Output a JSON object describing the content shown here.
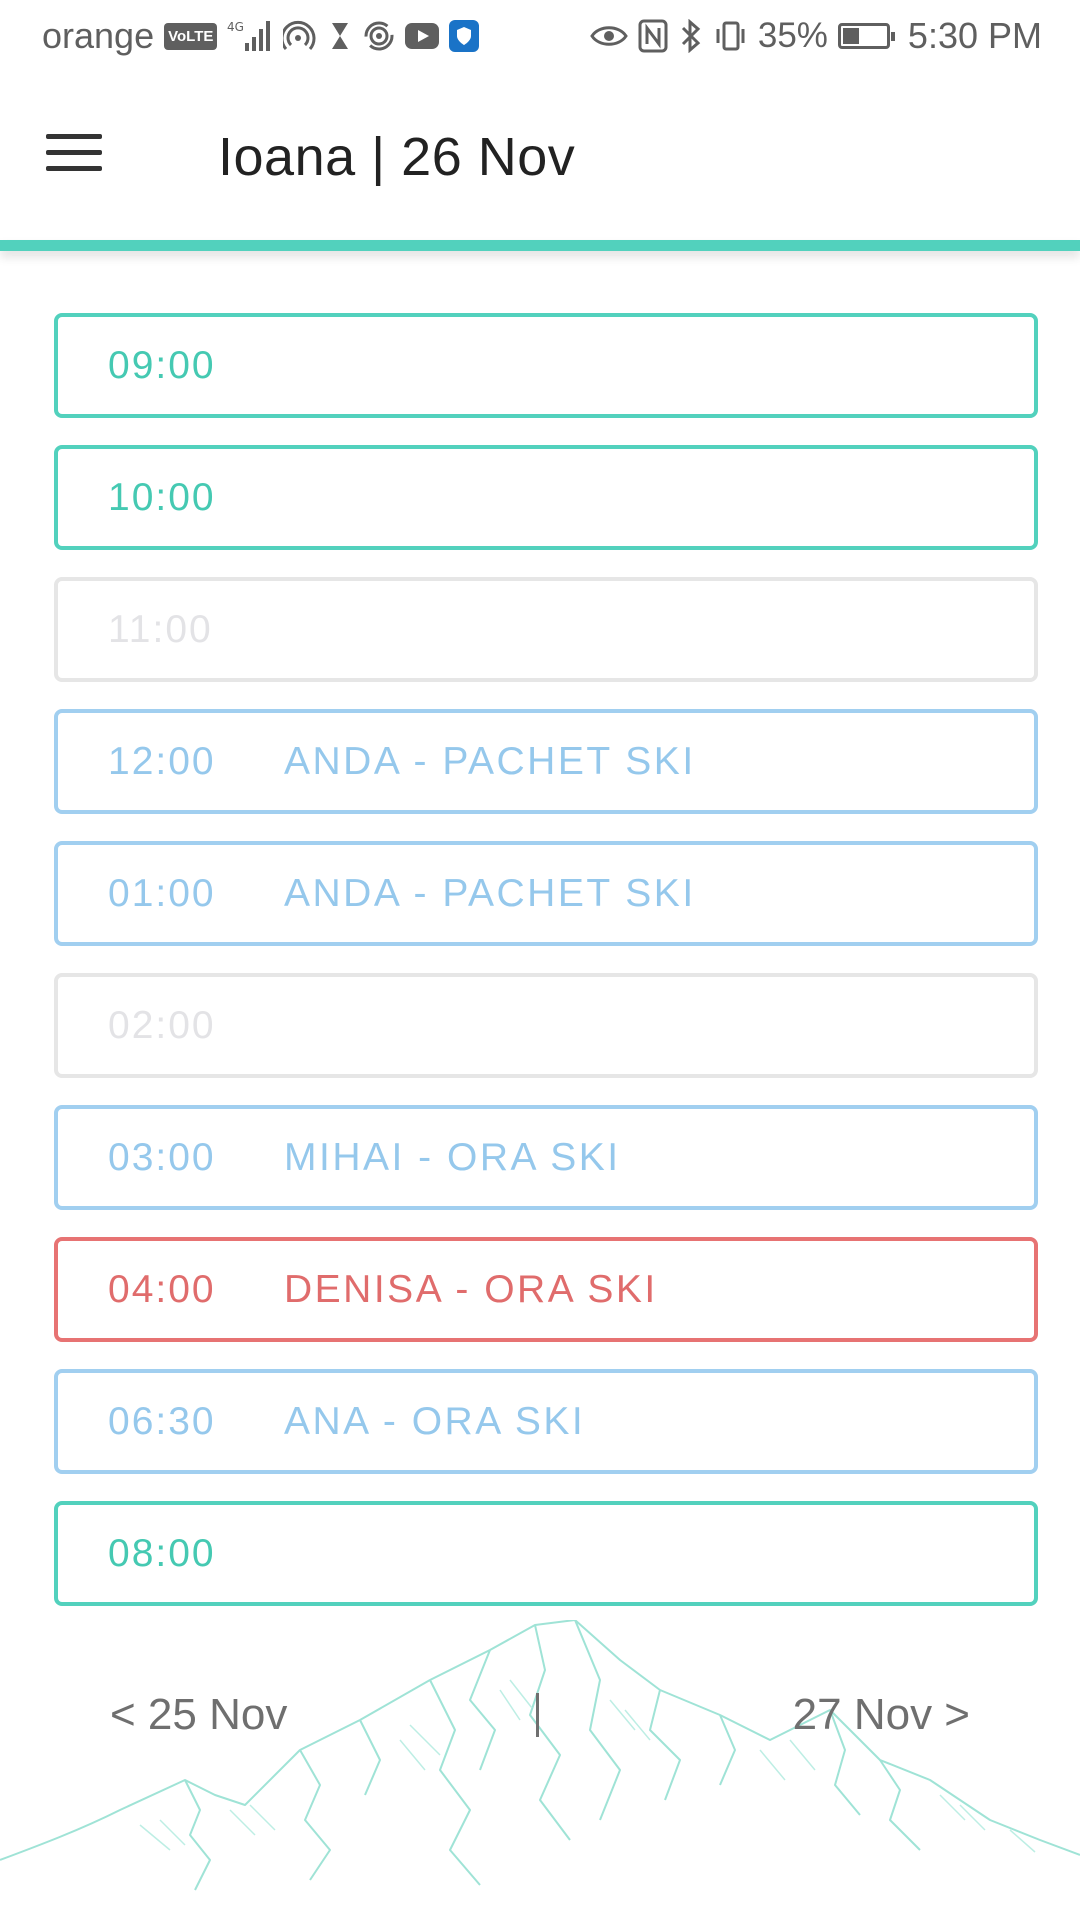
{
  "status_bar": {
    "carrier": "orange",
    "volte_badge": "VoLTE",
    "network": "4G",
    "battery": "35%",
    "time": "5:30 PM"
  },
  "header": {
    "title": "Ioana | 26 Nov",
    "accent_color": "#52d1bd"
  },
  "slots": [
    {
      "time": "09:00",
      "booking": "",
      "status": "available"
    },
    {
      "time": "10:00",
      "booking": "",
      "status": "available"
    },
    {
      "time": "11:00",
      "booking": "",
      "status": "disabled"
    },
    {
      "time": "12:00",
      "booking": "ANDA - PACHET SKI",
      "status": "booked"
    },
    {
      "time": "01:00",
      "booking": "ANDA - PACHET SKI",
      "status": "booked"
    },
    {
      "time": "02:00",
      "booking": "",
      "status": "disabled"
    },
    {
      "time": "03:00",
      "booking": "MIHAI - ORA SKI",
      "status": "booked"
    },
    {
      "time": "04:00",
      "booking": "DENISA - ORA SKI",
      "status": "alert"
    },
    {
      "time": "06:30",
      "booking": "ANA - ORA SKI",
      "status": "booked"
    },
    {
      "time": "08:00",
      "booking": "",
      "status": "available"
    }
  ],
  "colors": {
    "available": "#52d1bd",
    "disabled": "#e6e6e6",
    "booked": "#a1cff0",
    "alert": "#e77373"
  },
  "footer": {
    "prev_label": "< 25 Nov",
    "next_label": "27 Nov >"
  }
}
